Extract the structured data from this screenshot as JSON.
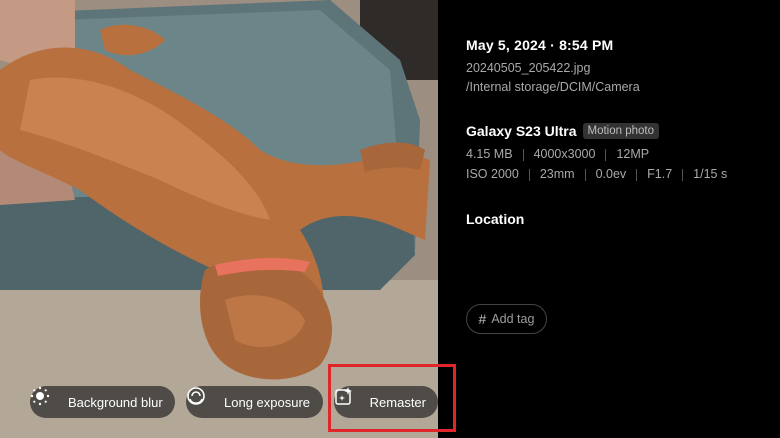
{
  "photo_actions": {
    "background_blur": {
      "label": "Background blur",
      "icon": "background-blur-icon"
    },
    "long_exposure": {
      "label": "Long exposure",
      "icon": "long-exposure-icon"
    },
    "remaster": {
      "label": "Remaster",
      "icon": "remaster-sparkle-icon"
    }
  },
  "details": {
    "datetime": "May 5, 2024 · 8:54 PM",
    "filename": "20240505_205422.jpg",
    "path": "/Internal storage/DCIM/Camera",
    "device": "Galaxy S23 Ultra",
    "badge": "Motion photo",
    "file_size": "4.15 MB",
    "resolution": "4000x3000",
    "megapixels": "12MP",
    "iso": "ISO 2000",
    "focal_length": "23mm",
    "exposure_value": "0.0ev",
    "aperture": "F1.7",
    "shutter": "1/15 s",
    "location_label": "Location",
    "add_tag_label": "Add tag"
  },
  "colors": {
    "highlight": "#e0252b",
    "background": "#000000",
    "secondary_text": "#a9a9a9"
  }
}
